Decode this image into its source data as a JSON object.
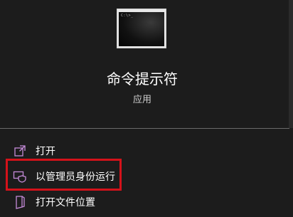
{
  "app": {
    "name": "命令提示符",
    "type": "应用",
    "icon": "command-prompt-icon",
    "icon_prompt_text": "C:\\>_"
  },
  "actions": [
    {
      "label": "打开",
      "icon": "open-external-icon"
    },
    {
      "label": "以管理员身份运行",
      "icon": "run-as-admin-shield-icon"
    },
    {
      "label": "打开文件位置",
      "icon": "file-location-icon"
    }
  ],
  "colors": {
    "background": "#1c1c1c",
    "accent_icon": "#c58bd9",
    "highlight_border": "#d4121a",
    "divider": "#6a6a6a"
  }
}
